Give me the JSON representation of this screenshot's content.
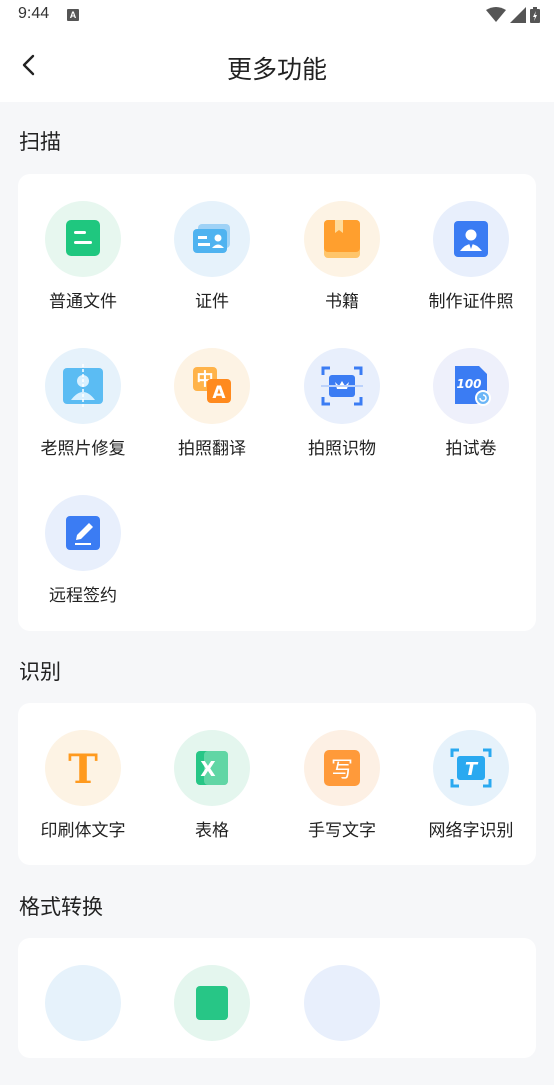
{
  "status_bar": {
    "time": "9:44",
    "notification_icon": "A"
  },
  "header": {
    "title": "更多功能",
    "back_icon": "chevron-left-icon"
  },
  "sections": [
    {
      "title": "扫描",
      "items": [
        {
          "label": "普通文件",
          "icon": "document-icon",
          "circle_color": "#e7f7ef"
        },
        {
          "label": "证件",
          "icon": "id-card-icon",
          "circle_color": "#e6f2fb"
        },
        {
          "label": "书籍",
          "icon": "book-icon",
          "circle_color": "#fdf3e4"
        },
        {
          "label": "制作证件照",
          "icon": "id-photo-icon",
          "circle_color": "#e8effc"
        },
        {
          "label": "老照片修复",
          "icon": "photo-restore-icon",
          "circle_color": "#e6f2fb"
        },
        {
          "label": "拍照翻译",
          "icon": "translate-icon",
          "circle_color": "#fdf3e4"
        },
        {
          "label": "拍照识物",
          "icon": "object-scan-icon",
          "circle_color": "#e8effc"
        },
        {
          "label": "拍试卷",
          "icon": "exam-paper-icon",
          "circle_color": "#eef0fb"
        },
        {
          "label": "远程签约",
          "icon": "sign-pen-icon",
          "circle_color": "#e8effc"
        }
      ]
    },
    {
      "title": "识别",
      "items": [
        {
          "label": "印刷体文字",
          "icon": "print-text-icon",
          "circle_color": "#fdf3e4",
          "glyph": "T"
        },
        {
          "label": "表格",
          "icon": "excel-icon",
          "circle_color": "#e4f6ee",
          "glyph": "X"
        },
        {
          "label": "手写文字",
          "icon": "handwriting-icon",
          "circle_color": "#fdf0e4",
          "glyph": "写"
        },
        {
          "label": "网络字识别",
          "icon": "web-text-icon",
          "circle_color": "#e6f2fb",
          "glyph": "T"
        }
      ]
    },
    {
      "title": "格式转换",
      "items": [
        {
          "icon": "convert-icon-1",
          "circle_color": "#e6f2fb"
        },
        {
          "icon": "convert-icon-2",
          "circle_color": "#e4f6ee"
        },
        {
          "icon": "convert-icon-3",
          "circle_color": "#e8effc"
        }
      ]
    }
  ]
}
